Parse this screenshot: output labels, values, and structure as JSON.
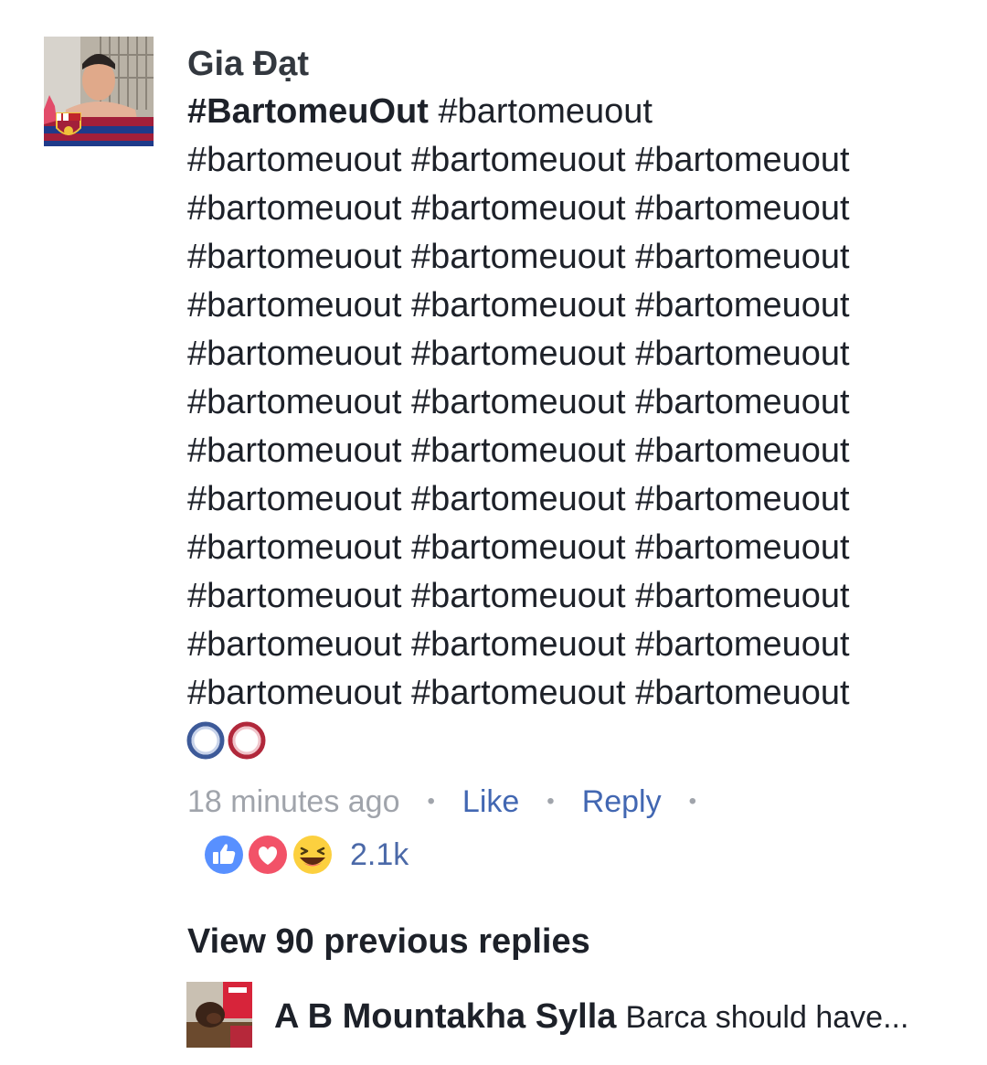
{
  "comment": {
    "author": "Gia Đạt",
    "lines": [
      {
        "strong": "#BartomeuOut",
        "rest": " #bartomeuout"
      },
      {
        "strong": "",
        "rest": "#bartomeuout #bartomeuout #bartomeuout"
      },
      {
        "strong": "",
        "rest": "#bartomeuout #bartomeuout #bartomeuout"
      },
      {
        "strong": "",
        "rest": "#bartomeuout #bartomeuout #bartomeuout"
      },
      {
        "strong": "",
        "rest": "#bartomeuout #bartomeuout #bartomeuout"
      },
      {
        "strong": "",
        "rest": "#bartomeuout #bartomeuout #bartomeuout"
      },
      {
        "strong": "",
        "rest": "#bartomeuout #bartomeuout #bartomeuout"
      },
      {
        "strong": "",
        "rest": "#bartomeuout #bartomeuout #bartomeuout"
      },
      {
        "strong": "",
        "rest": "#bartomeuout #bartomeuout #bartomeuout"
      },
      {
        "strong": "",
        "rest": "#bartomeuout #bartomeuout #bartomeuout"
      },
      {
        "strong": "",
        "rest": "#bartomeuout #bartomeuout #bartomeuout"
      },
      {
        "strong": "",
        "rest": "#bartomeuout #bartomeuout #bartomeuout"
      },
      {
        "strong": "",
        "rest": "#bartomeuout #bartomeuout #bartomeuout"
      }
    ],
    "emojis": [
      "blue-circle-icon",
      "red-circle-icon"
    ],
    "timestamp": "18 minutes ago",
    "like_label": "Like",
    "reply_label": "Reply",
    "reactions": [
      "like-reaction-icon",
      "love-reaction-icon",
      "haha-reaction-icon"
    ],
    "reaction_count": "2.1k"
  },
  "replies": {
    "view_previous_label": "View 90 previous replies",
    "latest": {
      "author": "A B Mountakha Sylla",
      "text": "Barca should have..."
    }
  },
  "colors": {
    "link": "#4267b2",
    "muted": "#a0a4ab",
    "text": "#1d2129",
    "like_blue": "#5890ff",
    "love_red": "#f25268",
    "haha_yellow": "#fcd03f"
  }
}
